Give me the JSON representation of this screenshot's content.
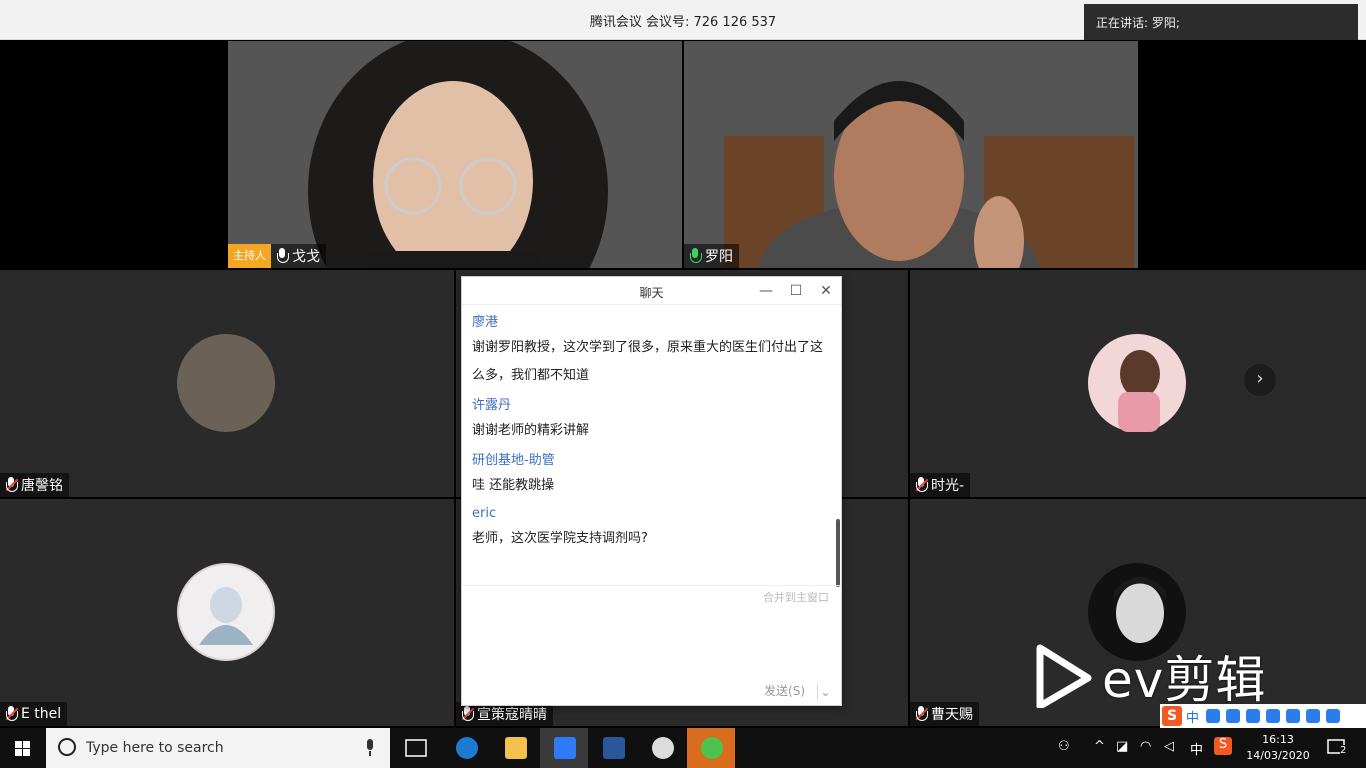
{
  "titlebar": {
    "app": "腾讯会议",
    "meeting_id": "会议号: 726 126 537",
    "speaking": "正在讲话: 罗阳;"
  },
  "tiles": {
    "t1": {
      "badge": "主持人",
      "name": "戈戈"
    },
    "t2": {
      "name": "罗阳"
    },
    "t3": {
      "name": "唐謦铭"
    },
    "t4": {
      "name": "时光-"
    },
    "t5": {
      "name": "E thel"
    },
    "t6": {
      "name": "宣策寇晴晴"
    },
    "t7": {
      "name": "曹天赐"
    }
  },
  "chat": {
    "title": "聊天",
    "messages": [
      {
        "sender": "廖港",
        "text": "谢谢罗阳教授，这次学到了很多，原来重大的医生们付出了这么多，我们都不知道"
      },
      {
        "sender": "许露丹",
        "text": "谢谢老师的精彩讲解"
      },
      {
        "sender": "研创基地-助管",
        "text": "哇 还能教跳操"
      },
      {
        "sender": "eric",
        "text": "老师，这次医学院支持调剂吗?"
      }
    ],
    "merge_label": "合并到主窗口",
    "send_label": "发送(S)"
  },
  "watermark": {
    "text": "ev剪辑"
  },
  "taskbar": {
    "search_placeholder": "Type here to search",
    "ime": "中",
    "time": "16:13",
    "date": "14/03/2020",
    "notif_count": "2"
  },
  "colors": {
    "host_badge": "#f5a623",
    "sender": "#3d6fc4",
    "mic_active": "#3ad36a",
    "mic_muted_slash": "#e0433a"
  }
}
